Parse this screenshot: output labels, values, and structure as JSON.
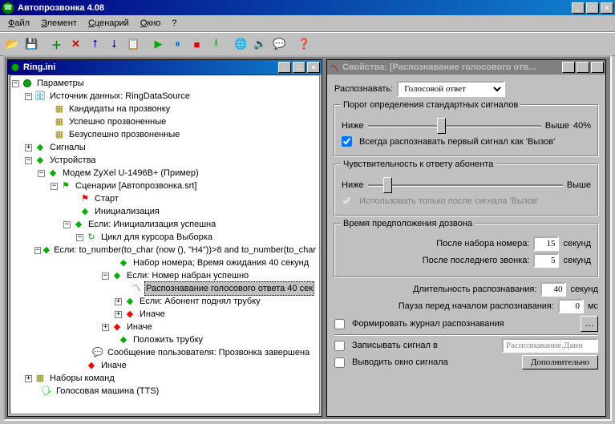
{
  "window": {
    "title": "Автопрозвонка 4.08"
  },
  "menu": {
    "file": "Файл",
    "element": "Элемент",
    "scenario": "Сценарий",
    "window": "Окно",
    "help": "?"
  },
  "toolbar_icons": {
    "open": "📂",
    "save": "💾",
    "add": "＋",
    "del": "✕",
    "up": "⭡",
    "down": "⭣",
    "copy": "📋",
    "run": "▶",
    "pause": "⏸",
    "stop": "■",
    "step": "⭳",
    "play": "▶",
    "globe": "🌐",
    "audio": "🔊",
    "chat": "💬",
    "about": "❓"
  },
  "left": {
    "title": "Ring.ini",
    "tree": {
      "params": "Параметры",
      "datasource": "Источник данных: RingDataSource",
      "candidates": "Кандидаты на прозвонку",
      "success": "Успешно прозвоненные",
      "fail": "Безуспешно прозвоненные",
      "signals": "Сигналы",
      "devices": "Устройства",
      "modem": "Модем ZyXel U-1496B+ (Пример)",
      "scenarii": "Сценарии [Автопрозвонка.srt]",
      "start": "Старт",
      "init": "Инициализация",
      "if_init": "Если: Инициализация успешна",
      "cycle": "Цикл для курсора Выборка",
      "if_tonum": "Если: to_number(to_char (now (), \"H4\"))>8 and to_number(to_char",
      "dialset": "Набор номера; Время ожидания 40 секунд",
      "if_dialed": "Если: Номер набран успешно",
      "recognize": "Распознавание голосового ответа 40 сек",
      "if_answer": "Если: Абонент поднял трубку",
      "else1": "Иначе",
      "else2": "Иначе",
      "hangup": "Положить трубку",
      "usermsg": "Сообщение пользователя: Прозвонка завершена",
      "else3": "Иначе",
      "cmdsets": "Наборы команд",
      "tts": "Голосовая машина (TTS)"
    }
  },
  "right": {
    "title": "Свойства: [Распознавание голосового отв...",
    "recognize_lbl": "Распознавать:",
    "recognize_val": "Голосовой ответ",
    "g_threshold": "Порог определения стандартных сигналов",
    "lower": "Ниже",
    "higher": "Выше",
    "thresh_val": "40%",
    "cb_always": "Всегда распознавать первый сигнал как 'Вызов'",
    "g_sens": "Чувствительность к ответу абонента",
    "cb_after_ring": "Использовать только после сигнала 'Вызов'",
    "g_assume": "Время предположения дозвона",
    "after_dial_lbl": "После набора номера:",
    "after_dial_val": "15",
    "after_ring_lbl": "После последнего звонка:",
    "after_ring_val": "5",
    "seconds": "секунд",
    "rec_len_lbl": "Длительность распознавания:",
    "rec_len_val": "40",
    "pause_lbl": "Пауза перед началом распознавания:",
    "pause_val": "0",
    "ms": "мс",
    "cb_log": "Формировать журнал распознавания",
    "cb_writesig": "Записывать сигнал в",
    "writesig_path": "Распознавание.Данн",
    "cb_showwin": "Выводить окно сигнала",
    "btn_more": "Дополнительно"
  }
}
